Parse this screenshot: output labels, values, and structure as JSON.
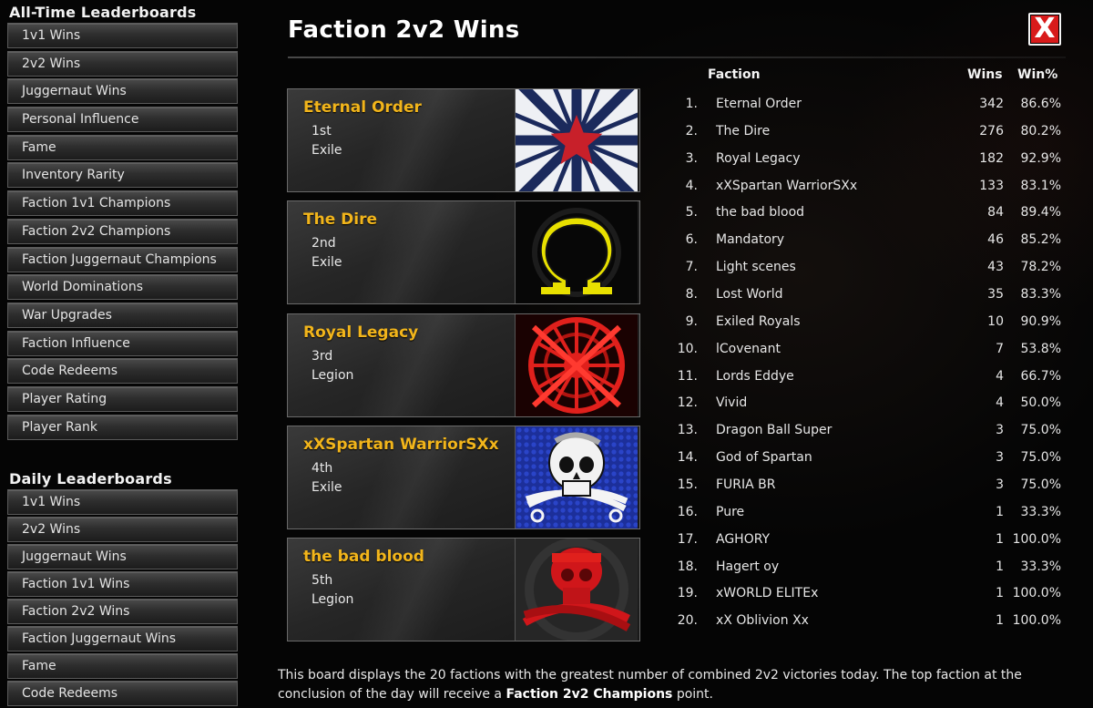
{
  "sidebar": {
    "all_time_title": "All-Time Leaderboards",
    "all_time_items": [
      "1v1 Wins",
      "2v2 Wins",
      "Juggernaut Wins",
      "Personal Influence",
      "Fame",
      "Inventory Rarity",
      "Faction 1v1 Champions",
      "Faction 2v2 Champions",
      "Faction Juggernaut Champions",
      "World Dominations",
      "War Upgrades",
      "Faction Influence",
      "Code Redeems",
      "Player Rating",
      "Player Rank"
    ],
    "daily_title": "Daily Leaderboards",
    "daily_items": [
      "1v1 Wins",
      "2v2 Wins",
      "Juggernaut Wins",
      "Faction 1v1 Wins",
      "Faction 2v2 Wins",
      "Faction Juggernaut Wins",
      "Fame",
      "Code Redeems"
    ]
  },
  "main": {
    "title": "Faction 2v2 Wins",
    "close_glyph": "X"
  },
  "top_factions": [
    {
      "name": "Eternal Order",
      "rank": "1st",
      "allegiance": "Exile",
      "emblem": "star-rays-emblem"
    },
    {
      "name": "The Dire",
      "rank": "2nd",
      "allegiance": "Exile",
      "emblem": "omega-emblem"
    },
    {
      "name": "Royal Legacy",
      "rank": "3rd",
      "allegiance": "Legion",
      "emblem": "red-wheel-emblem"
    },
    {
      "name": "xXSpartan WarriorSXx",
      "rank": "4th",
      "allegiance": "Exile",
      "emblem": "skull-crossed-swords-emblem"
    },
    {
      "name": "the bad blood",
      "rank": "5th",
      "allegiance": "Legion",
      "emblem": "red-skull-emblem"
    }
  ],
  "table": {
    "headers": {
      "faction": "Faction",
      "wins": "Wins",
      "win_pct": "Win%"
    },
    "rows": [
      {
        "num": "1.",
        "faction": "Eternal Order",
        "wins": "342",
        "win_pct": "86.6%"
      },
      {
        "num": "2.",
        "faction": "The Dire",
        "wins": "276",
        "win_pct": "80.2%"
      },
      {
        "num": "3.",
        "faction": "Royal Legacy",
        "wins": "182",
        "win_pct": "92.9%"
      },
      {
        "num": "4.",
        "faction": "xXSpartan WarriorSXx",
        "wins": "133",
        "win_pct": "83.1%"
      },
      {
        "num": "5.",
        "faction": "the bad blood",
        "wins": "84",
        "win_pct": "89.4%"
      },
      {
        "num": "6.",
        "faction": "Mandatory",
        "wins": "46",
        "win_pct": "85.2%"
      },
      {
        "num": "7.",
        "faction": "Light scenes",
        "wins": "43",
        "win_pct": "78.2%"
      },
      {
        "num": "8.",
        "faction": "Lost World",
        "wins": "35",
        "win_pct": "83.3%"
      },
      {
        "num": "9.",
        "faction": "Exiled Royals",
        "wins": "10",
        "win_pct": "90.9%"
      },
      {
        "num": "10.",
        "faction": "lCovenant",
        "wins": "7",
        "win_pct": "53.8%"
      },
      {
        "num": "11.",
        "faction": "Lords Eddye",
        "wins": "4",
        "win_pct": "66.7%"
      },
      {
        "num": "12.",
        "faction": "Vivid",
        "wins": "4",
        "win_pct": "50.0%"
      },
      {
        "num": "13.",
        "faction": "Dragon Ball Super",
        "wins": "3",
        "win_pct": "75.0%"
      },
      {
        "num": "14.",
        "faction": "God of Spartan",
        "wins": "3",
        "win_pct": "75.0%"
      },
      {
        "num": "15.",
        "faction": "FURIA BR",
        "wins": "3",
        "win_pct": "75.0%"
      },
      {
        "num": "16.",
        "faction": "Pure",
        "wins": "1",
        "win_pct": "33.3%"
      },
      {
        "num": "17.",
        "faction": "AGHORY",
        "wins": "1",
        "win_pct": "100.0%"
      },
      {
        "num": "18.",
        "faction": "Hagert oy",
        "wins": "1",
        "win_pct": "33.3%"
      },
      {
        "num": "19.",
        "faction": "xWORLD ELITEx",
        "wins": "1",
        "win_pct": "100.0%"
      },
      {
        "num": "20.",
        "faction": "xX Oblivion Xx",
        "wins": "1",
        "win_pct": "100.0%"
      }
    ]
  },
  "footer": {
    "text_before": "This board displays the 20 factions with the greatest number of combined 2v2 victories today. The top faction at the conclusion of the day will receive a ",
    "bold": "Faction 2v2 Champions",
    "text_after": " point."
  },
  "colors": {
    "faction_name": "#f2b51b",
    "close_button": "#d81b1b"
  }
}
